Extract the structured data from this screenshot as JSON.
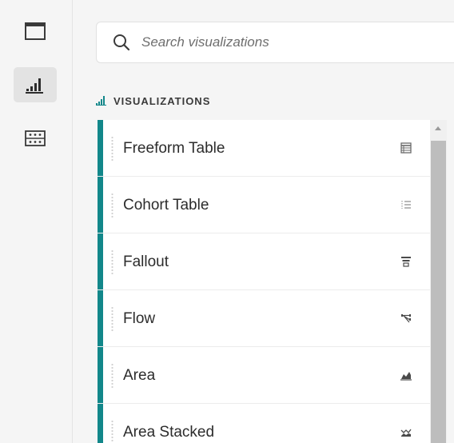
{
  "rail": {
    "items": [
      {
        "name": "panels-icon",
        "active": false
      },
      {
        "name": "visualizations-icon",
        "active": true
      },
      {
        "name": "components-icon",
        "active": false
      }
    ]
  },
  "search": {
    "placeholder": "Search visualizations",
    "value": ""
  },
  "section": {
    "title": "VISUALIZATIONS",
    "icon": "bar-chart-icon"
  },
  "visualizations": [
    {
      "label": "Freeform Table",
      "icon": "freeform-table-icon"
    },
    {
      "label": "Cohort Table",
      "icon": "cohort-table-icon"
    },
    {
      "label": "Fallout",
      "icon": "fallout-icon"
    },
    {
      "label": "Flow",
      "icon": "flow-icon"
    },
    {
      "label": "Area",
      "icon": "area-icon"
    },
    {
      "label": "Area Stacked",
      "icon": "area-stacked-icon"
    }
  ],
  "colors": {
    "accent": "#12878a",
    "background": "#f5f5f5",
    "item_background": "#ffffff"
  }
}
